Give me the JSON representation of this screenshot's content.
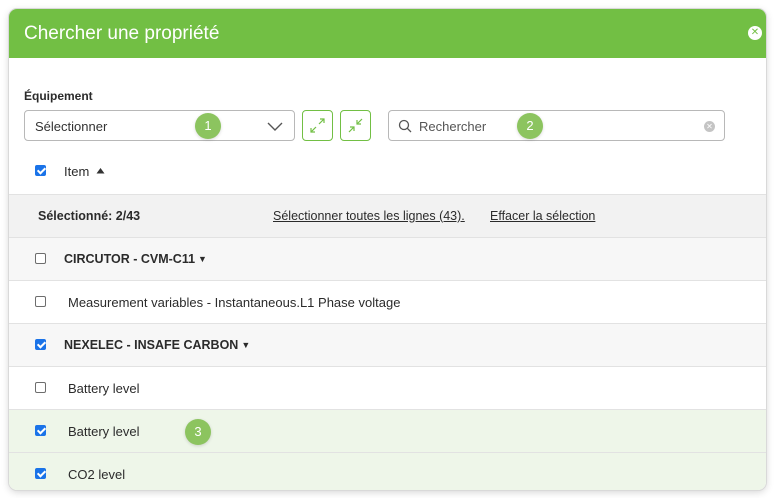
{
  "dialog": {
    "title": "Chercher une propriété",
    "close_glyph": "✕"
  },
  "filters": {
    "equipment_label": "Équipement",
    "equipment_select_value": "Sélectionner",
    "search_placeholder": "Rechercher"
  },
  "badges": [
    "1",
    "2",
    "3"
  ],
  "table": {
    "column_header": "Item",
    "header_checked": true,
    "summary": {
      "selected_text": "Sélectionné: 2/43",
      "select_all_link": "Sélectionner toutes les lignes (43).",
      "clear_link": "Effacer la sélection"
    },
    "rows": [
      {
        "type": "group",
        "label": "CIRCUTOR - CVM-C11",
        "checked": false
      },
      {
        "type": "item",
        "label": "Measurement variables - Instantaneous.L1 Phase voltage",
        "checked": false
      },
      {
        "type": "group",
        "label": "NEXELEC - INSAFE CARBON",
        "checked": true
      },
      {
        "type": "item",
        "label": "Battery level",
        "checked": false
      },
      {
        "type": "item",
        "label": "Battery level",
        "checked": true
      },
      {
        "type": "item",
        "label": "CO2 level",
        "checked": true
      }
    ]
  },
  "colors": {
    "primary_green": "#72bf44",
    "badge_green": "#8cc45f",
    "checkbox_blue": "#1a73e8",
    "selected_row": "#eef6e9"
  },
  "icons": {
    "expand": "expand-arrows-icon",
    "collapse": "collapse-arrows-icon",
    "search": "search-icon",
    "clear": "clear-search-icon",
    "sort": "sort-up-icon",
    "caret": "caret-down-icon",
    "chevron": "chevron-down-icon",
    "close": "close-icon"
  }
}
